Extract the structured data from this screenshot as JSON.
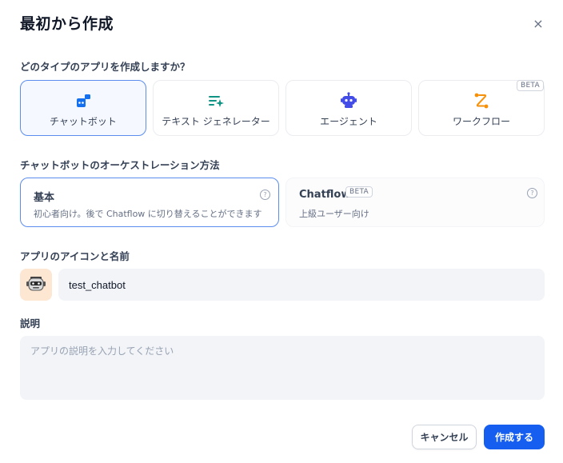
{
  "dialog": {
    "title": "最初から作成",
    "close_label": "×"
  },
  "app_type": {
    "label": "どのタイプのアプリを作成しますか？",
    "options": [
      {
        "label": "チャットボット",
        "icon": "chatbot-icon",
        "selected": true
      },
      {
        "label": "テキスト ジェネレーター",
        "icon": "text-generator-icon",
        "selected": false
      },
      {
        "label": "エージェント",
        "icon": "agent-robot-icon",
        "selected": false
      },
      {
        "label": "ワークフロー",
        "icon": "workflow-icon",
        "selected": false,
        "badge": "BETA"
      }
    ]
  },
  "orchestration": {
    "label": "チャットボットのオーケストレーション方法",
    "options": [
      {
        "title": "基本",
        "desc": "初心者向け。後で Chatflow に切り替えることができます",
        "selected": true
      },
      {
        "title": "Chatflow",
        "badge": "BETA",
        "desc": "上級ユーザー向け",
        "selected": false
      }
    ]
  },
  "icon_name": {
    "label": "アプリのアイコンと名前",
    "avatar": "robot-face-emoji",
    "name_value": "test_chatbot"
  },
  "description": {
    "label": "説明",
    "placeholder": "アプリの説明を入力してください",
    "value": ""
  },
  "actions": {
    "cancel_label": "キャンセル",
    "create_label": "作成する"
  },
  "colors": {
    "primary": "#155eef",
    "selected_border": "#5b8def",
    "chatbot_icon": "#1570ef",
    "text_gen_icon": "#0e9384",
    "agent_icon": "#444ce7",
    "workflow_icon": "#f79009",
    "avatar_bg": "#fde6d2"
  }
}
